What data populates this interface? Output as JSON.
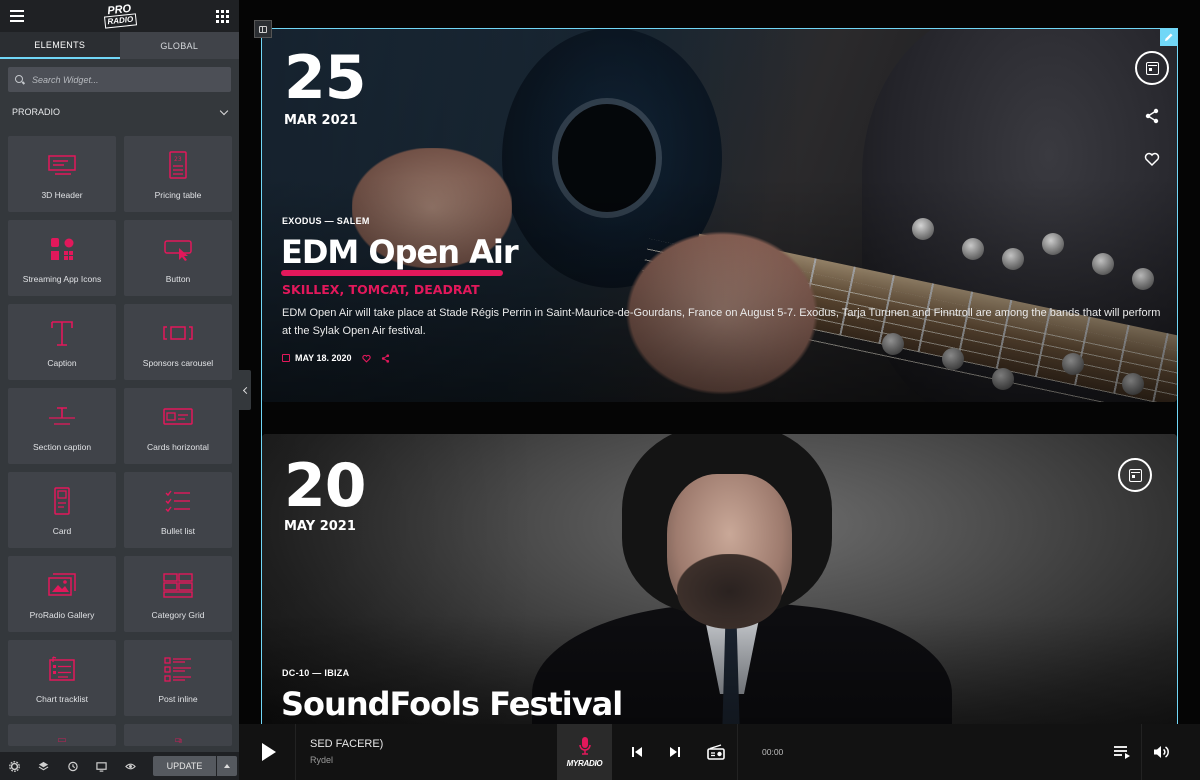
{
  "app": {
    "logo_line1": "PRO",
    "logo_line2": "RADIO"
  },
  "panel": {
    "tabs": [
      {
        "label": "ELEMENTS",
        "active": true
      },
      {
        "label": "GLOBAL",
        "active": false
      }
    ],
    "search_placeholder": "Search Widget...",
    "category": "PRORADIO",
    "widgets": [
      {
        "label": "3D Header",
        "icon": "3d-header-icon"
      },
      {
        "label": "Pricing table",
        "icon": "pricing-table-icon"
      },
      {
        "label": "Streaming App Icons",
        "icon": "streaming-app-icons-icon"
      },
      {
        "label": "Button",
        "icon": "button-icon"
      },
      {
        "label": "Caption",
        "icon": "caption-icon"
      },
      {
        "label": "Sponsors carousel",
        "icon": "sponsors-carousel-icon"
      },
      {
        "label": "Section caption",
        "icon": "section-caption-icon"
      },
      {
        "label": "Cards horizontal",
        "icon": "cards-horizontal-icon"
      },
      {
        "label": "Card",
        "icon": "card-icon"
      },
      {
        "label": "Bullet list",
        "icon": "bullet-list-icon"
      },
      {
        "label": "ProRadio Gallery",
        "icon": "gallery-icon"
      },
      {
        "label": "Category Grid",
        "icon": "category-grid-icon"
      },
      {
        "label": "Chart tracklist",
        "icon": "chart-tracklist-icon"
      },
      {
        "label": "Post inline",
        "icon": "post-inline-icon"
      }
    ],
    "footer": {
      "update_label": "UPDATE"
    }
  },
  "events": [
    {
      "day": "25",
      "month": "MAR 2021",
      "meta": "EXODUS — SALEM",
      "title": "EDM Open Air",
      "artists": "SKILLEX, TOMCAT, DEADRAT",
      "description": "EDM Open Air will take place at Stade Régis Perrin in Saint-Maurice-de-Gourdans, France on August 5-7. Exodus, Tarja Turunen and Finntroll are among the bands that will perform at the Sylak Open Air festival.",
      "date_line": "MAY 18. 2020"
    },
    {
      "day": "20",
      "month": "MAY 2021",
      "meta": "DC-10 — IBIZA",
      "title": "SoundFools Festival"
    }
  ],
  "player": {
    "track_title": "SED FACERE)",
    "track_artist": "Rydel",
    "station_name": "MYRADIO",
    "time": "00:00"
  },
  "colors": {
    "accent": "#e2185b",
    "editor_highlight": "#71d7f7",
    "panel_bg": "#34383c"
  }
}
